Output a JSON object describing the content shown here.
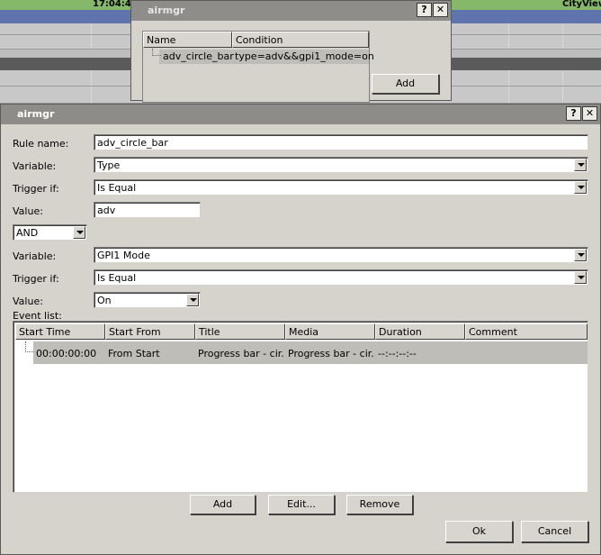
{
  "background": {
    "time_text": "17:04:4",
    "app_text": "CityView"
  },
  "back_dialog": {
    "title": "airmgr",
    "help_label": "?",
    "close_label": "✕",
    "columns": [
      "Name",
      "Condition"
    ],
    "rows": [
      {
        "name": "adv_circle_bar",
        "condition": "type=adv&&gpi1_mode=on"
      }
    ],
    "add_label": "Add"
  },
  "dialog": {
    "title": "airmgr",
    "help_label": "?",
    "close_label": "✕",
    "rule_name_label": "Rule name:",
    "rule_name_value": "adv_circle_bar",
    "variable_label": "Variable:",
    "variable1_value": "Type",
    "trigger_label": "Trigger if:",
    "trigger1_value": "Is Equal",
    "value_label": "Value:",
    "value1_value": "adv",
    "logic_value": "AND",
    "variable2_value": "GPI1 Mode",
    "trigger2_value": "Is Equal",
    "value2_value": "On",
    "event_list_label": "Event list:",
    "event_columns": [
      "Start Time",
      "Start From",
      "Title",
      "Media",
      "Duration",
      "Comment"
    ],
    "events": [
      {
        "start_time": "00:00:00:00",
        "start_from": "From Start",
        "title": "Progress bar - cir...",
        "media": "Progress bar - cir...",
        "duration": "--:--:--:--",
        "comment": ""
      }
    ],
    "add_label": "Add",
    "edit_label": "Edit...",
    "remove_label": "Remove",
    "ok_label": "Ok",
    "cancel_label": "Cancel"
  }
}
